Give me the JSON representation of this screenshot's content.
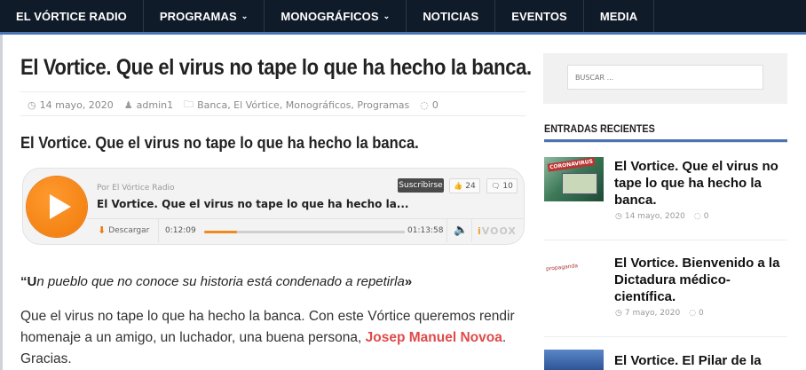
{
  "nav": {
    "items": [
      {
        "label": "EL VÓRTICE RADIO",
        "has_dropdown": false
      },
      {
        "label": "PROGRAMAS",
        "has_dropdown": true
      },
      {
        "label": "MONOGRÁFICOS",
        "has_dropdown": true
      },
      {
        "label": "NOTICIAS",
        "has_dropdown": false
      },
      {
        "label": "EVENTOS",
        "has_dropdown": false
      },
      {
        "label": "MEDIA",
        "has_dropdown": false
      }
    ],
    "caret": "⌄"
  },
  "post": {
    "title": "El Vortice. Que el virus no tape lo que ha hecho la banca.",
    "date": "14 mayo, 2020",
    "author": "admin1",
    "categories": "Banca, El Vórtice, Monográficos, Programas",
    "comments": "0",
    "subheading": "El Vortice. Que el virus no tape lo que ha hecho la banca.",
    "quote_first": "“U",
    "quote_rest": "n pueblo que no conoce su historia está condenado a repetirla",
    "quote_close": "»",
    "paragraph_before": "Que el virus no tape lo que ha hecho la banca. Con este Vórtice queremos rendir homenaje a un amigo, un luchador, una buena persona, ",
    "paragraph_link": "Josep Manuel Novoa",
    "paragraph_after": ". Gracias."
  },
  "player": {
    "by": "Por El Vórtice Radio",
    "episode_title": "El Vortice. Que el virus no tape lo que ha hecho la...",
    "subscribe_label": "Suscribirse",
    "likes": "24",
    "comments": "10",
    "download_label": "Descargar",
    "time_current": "0:12:09",
    "time_total": "01:13:58",
    "progress_fraction": 0.164,
    "brand_i": "i",
    "brand_rest": "VOOX"
  },
  "sidebar": {
    "search_placeholder": "BUSCAR ...",
    "recent_heading": "ENTRADAS RECIENTES",
    "recent": [
      {
        "title": "El Vortice. Que el virus no tape lo que ha hecho la banca.",
        "date": "14 mayo, 2020",
        "comments": "0",
        "thumb_tag": "CORONAVIRUS"
      },
      {
        "title": "El Vortice. Bienvenido a la Dictadura médico-científica.",
        "date": "7 mayo, 2020",
        "comments": "0",
        "thumb_tag": "propaganda"
      },
      {
        "title": "El Vortice. El Pilar de la"
      }
    ]
  },
  "colors": {
    "nav_bg": "#101b2a",
    "accent_blue": "#4a74b3",
    "link_red": "#e04a4a",
    "player_orange": "#f07a0b"
  },
  "icons": {
    "clock": "◷",
    "user": "♟",
    "folder": "🗀",
    "comment": "◌",
    "thumbs_up": "👍",
    "chat": "🗨",
    "download": "⬇",
    "volume": "🔈"
  }
}
